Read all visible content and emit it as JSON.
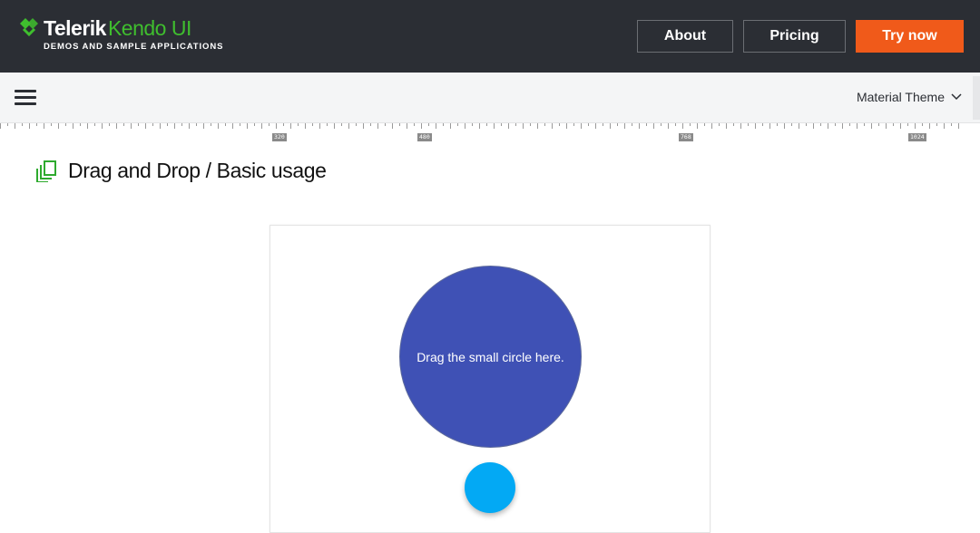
{
  "header": {
    "logo": {
      "brand_primary": "Telerik",
      "brand_secondary": "Kendo UI",
      "tagline": "DEMOS AND SAMPLE APPLICATIONS"
    },
    "nav": {
      "about_label": "About",
      "pricing_label": "Pricing",
      "try_label": "Try now"
    },
    "colors": {
      "background": "#2b2e34",
      "accent_green": "#3fbe2e",
      "cta_orange": "#f05a1a"
    }
  },
  "toolbar": {
    "menu_icon": "hamburger-icon",
    "theme_label": "Material Theme"
  },
  "ruler": {
    "labels": [
      "320",
      "480",
      "768",
      "1024"
    ]
  },
  "page": {
    "title_icon": "drag-drop-icon",
    "title": "Drag and Drop / Basic usage"
  },
  "demo": {
    "target_text": "Drag the small circle here.",
    "colors": {
      "target": "#3f51b5",
      "draggable": "#03a9f4"
    }
  }
}
